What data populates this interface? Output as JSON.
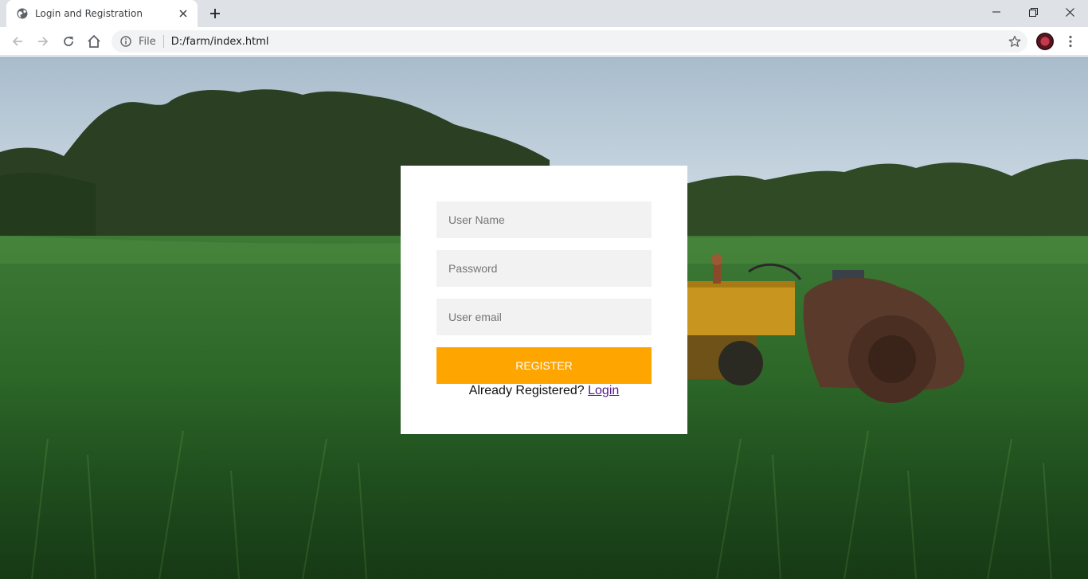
{
  "browser": {
    "tab_title": "Login and Registration",
    "url_scheme": "File",
    "url": "D:/farm/index.html"
  },
  "form": {
    "username_placeholder": "User Name",
    "password_placeholder": "Password",
    "email_placeholder": "User email",
    "register_label": "REGISTER",
    "already_text": "Already Registered?",
    "login_link": "Login"
  },
  "colors": {
    "accent": "#ffa500",
    "field_bg": "#f2f2f2",
    "visited_link": "#551a8b"
  },
  "icons": {
    "tab": "globe-icon",
    "close": "close-icon",
    "new_tab": "plus-icon",
    "back": "back-arrow-icon",
    "forward": "forward-arrow-icon",
    "reload": "reload-icon",
    "home": "home-icon",
    "site_info": "info-icon",
    "bookmark": "star-icon",
    "menu": "kebab-menu-icon"
  }
}
